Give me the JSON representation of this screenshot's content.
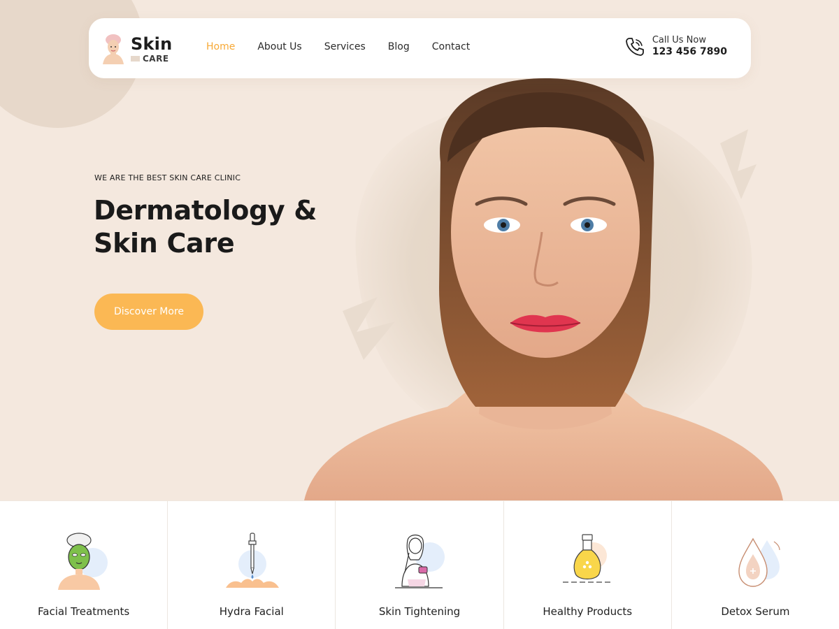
{
  "brand": {
    "name_top": "Skin",
    "name_bottom": "CARE"
  },
  "nav": {
    "items": [
      {
        "label": "Home",
        "active": true
      },
      {
        "label": "About Us",
        "active": false
      },
      {
        "label": "Services",
        "active": false
      },
      {
        "label": "Blog",
        "active": false
      },
      {
        "label": "Contact",
        "active": false
      }
    ]
  },
  "call": {
    "label": "Call Us Now",
    "number": "123 456 7890",
    "icon": "phone-icon"
  },
  "hero": {
    "eyebrow": "WE ARE THE BEST SKIN CARE CLINIC",
    "title_line1": "Dermatology &",
    "title_line2": "Skin Care",
    "cta_label": "Discover More"
  },
  "services": [
    {
      "label": "Facial Treatments",
      "icon": "face-mask-icon"
    },
    {
      "label": "Hydra Facial",
      "icon": "dropper-icon"
    },
    {
      "label": "Skin Tightening",
      "icon": "woman-cream-icon"
    },
    {
      "label": "Healthy Products",
      "icon": "oil-bottle-icon"
    },
    {
      "label": "Detox Serum",
      "icon": "serum-drops-icon"
    }
  ],
  "colors": {
    "accent": "#f7a936",
    "button": "#fbb854",
    "background": "#f4e8de"
  }
}
